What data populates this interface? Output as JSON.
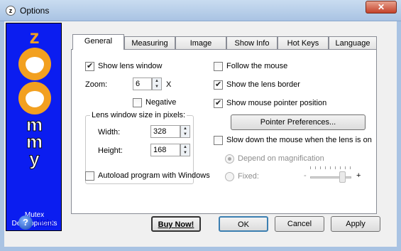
{
  "window": {
    "title": "Options",
    "close_glyph": "✕",
    "app_icon_glyph": "z"
  },
  "brand": {
    "letters_top": "z",
    "letters_bottom": [
      "m",
      "m",
      "y"
    ],
    "company_line1": "Mutex",
    "company_line2": "Developments"
  },
  "tabs": [
    {
      "label": "General",
      "active": true
    },
    {
      "label": "Measuring",
      "active": false
    },
    {
      "label": "Image",
      "active": false
    },
    {
      "label": "Show Info",
      "active": false
    },
    {
      "label": "Hot Keys",
      "active": false
    },
    {
      "label": "Language",
      "active": false
    }
  ],
  "general": {
    "show_lens_window": {
      "label": "Show lens window",
      "checked": true
    },
    "zoom": {
      "label": "Zoom:",
      "value": "6",
      "suffix": "X"
    },
    "negative": {
      "label": "Negative",
      "checked": false
    },
    "lens_size": {
      "title": "Lens window size in pixels:",
      "width_label": "Width:",
      "width_value": "328",
      "height_label": "Height:",
      "height_value": "168"
    },
    "autoload": {
      "label": "Autoload program with Windows",
      "checked": false
    },
    "follow_mouse": {
      "label": "Follow the mouse",
      "checked": false
    },
    "show_lens_border": {
      "label": "Show the lens border",
      "checked": true
    },
    "show_pointer_position": {
      "label": "Show mouse pointer position",
      "checked": true
    },
    "pointer_preferences_label": "Pointer Preferences...",
    "slow_down": {
      "label": "Slow down the mouse when the lens is on",
      "checked": false
    },
    "depend_on_magnification": {
      "label": "Depend on magnification",
      "selected": true,
      "enabled": false
    },
    "fixed": {
      "label": "Fixed:",
      "selected": false,
      "enabled": false
    },
    "slider": {
      "min_label": "-",
      "max_label": "+"
    }
  },
  "footer": {
    "help_glyph": "?",
    "help_label": "Help",
    "buy_now_label": "Buy Now!",
    "ok_label": "OK",
    "cancel_label": "Cancel",
    "apply_label": "Apply"
  }
}
